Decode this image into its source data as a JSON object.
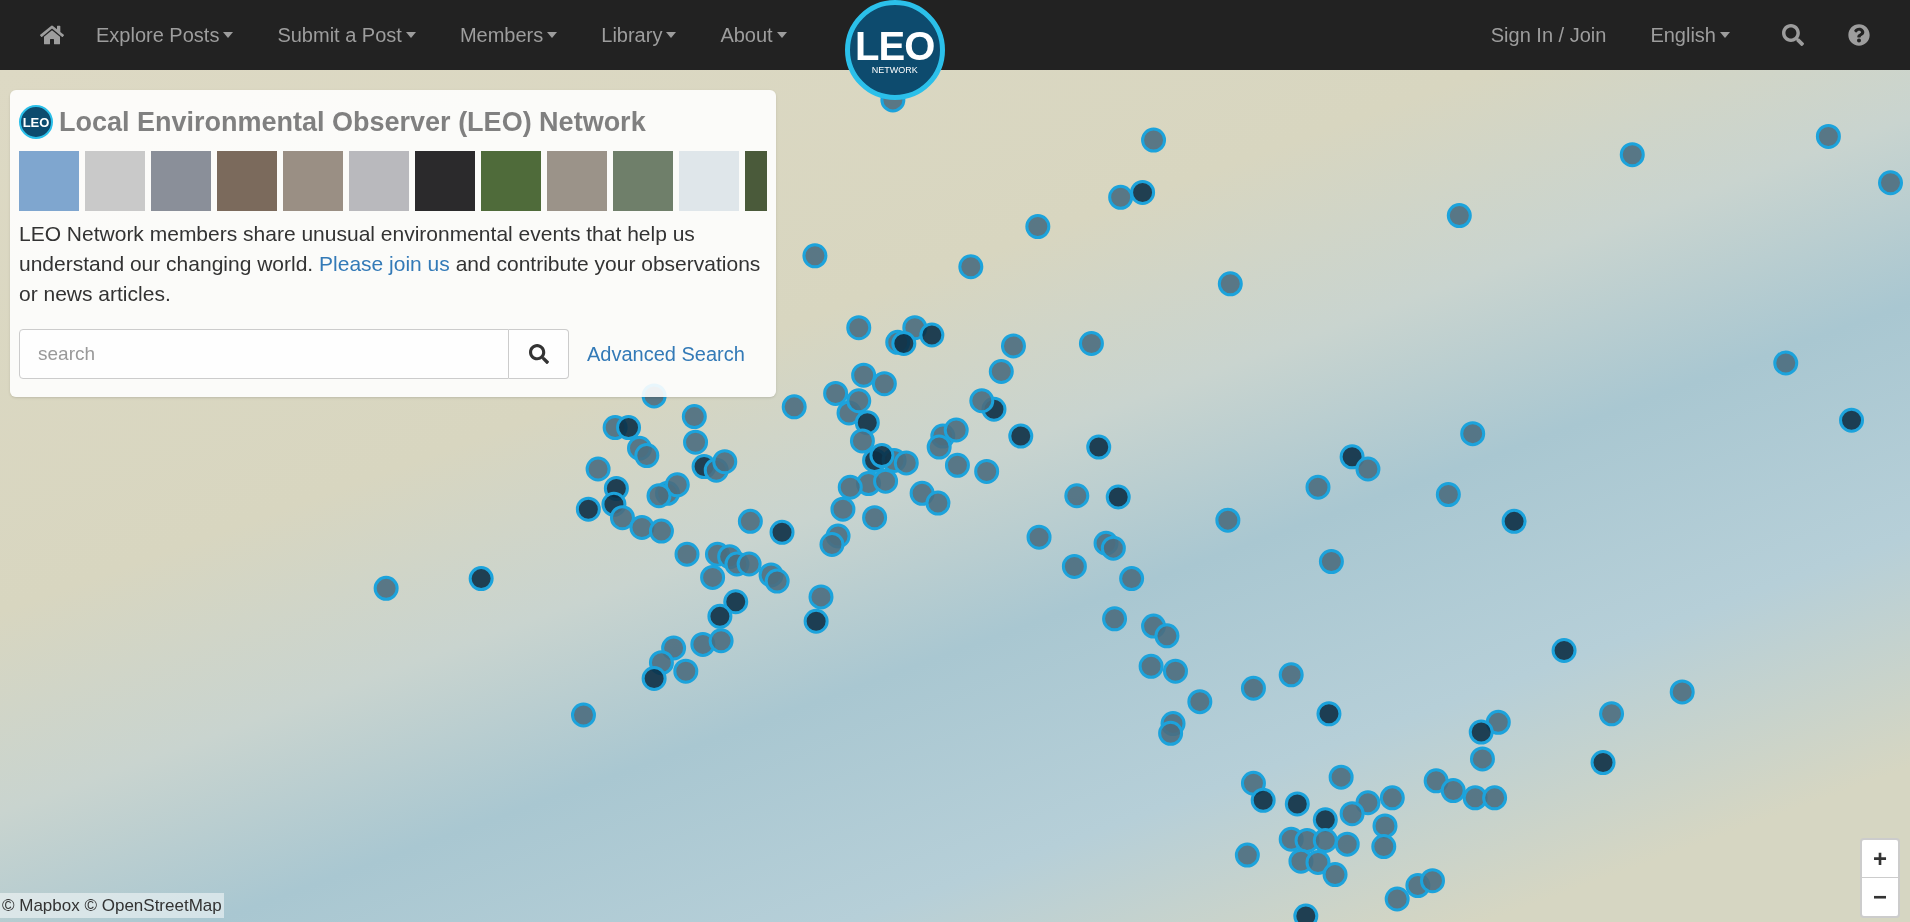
{
  "navbar": {
    "left_items": [
      {
        "label": "Explore Posts",
        "dropdown": true
      },
      {
        "label": "Submit a Post",
        "dropdown": true
      },
      {
        "label": "Members",
        "dropdown": true
      },
      {
        "label": "Library",
        "dropdown": true
      },
      {
        "label": "About",
        "dropdown": true
      }
    ],
    "logo": {
      "title": "LEO",
      "subtitle": "NETWORK"
    },
    "right_items": [
      {
        "label": "Sign In / Join",
        "dropdown": false
      },
      {
        "label": "English",
        "dropdown": true
      }
    ]
  },
  "intro_card": {
    "logo_text": "LEO",
    "title": "Local Environmental Observer (LEO) Network",
    "description_before": "LEO Network members share unusual environmental events that help us understand our changing world.",
    "description_link": "Please join us",
    "description_after": "and contribute your observations or news articles.",
    "search": {
      "placeholder": "search"
    },
    "advanced_search": "Advanced Search"
  },
  "map": {
    "zoom_in": "+",
    "zoom_out": "−",
    "attribution": "© Mapbox © OpenStreetMap"
  }
}
